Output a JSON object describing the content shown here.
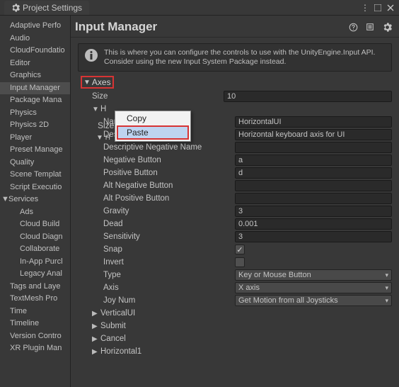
{
  "window": {
    "title": "Project Settings"
  },
  "sidebar": {
    "items": [
      {
        "label": "Adaptive Perfo",
        "child": false
      },
      {
        "label": "Audio",
        "child": false
      },
      {
        "label": "CloudFoundatio",
        "child": false
      },
      {
        "label": "Editor",
        "child": false
      },
      {
        "label": "Graphics",
        "child": false
      },
      {
        "label": "Input Manager",
        "child": false,
        "selected": true
      },
      {
        "label": "Package Mana",
        "child": false
      },
      {
        "label": "Physics",
        "child": false
      },
      {
        "label": "Physics 2D",
        "child": false
      },
      {
        "label": "Player",
        "child": false
      },
      {
        "label": "Preset Manage",
        "child": false
      },
      {
        "label": "Quality",
        "child": false
      },
      {
        "label": "Scene Templat",
        "child": false
      },
      {
        "label": "Script Executio",
        "child": false
      },
      {
        "label": "Services",
        "child": false,
        "fold": "▼"
      },
      {
        "label": "Ads",
        "child": true
      },
      {
        "label": "Cloud Build",
        "child": true
      },
      {
        "label": "Cloud Diagn",
        "child": true
      },
      {
        "label": "Collaborate",
        "child": true
      },
      {
        "label": "In-App Purcl",
        "child": true
      },
      {
        "label": "Legacy Anal",
        "child": true
      },
      {
        "label": "Tags and Laye",
        "child": false
      },
      {
        "label": "TextMesh Pro",
        "child": false
      },
      {
        "label": "Time",
        "child": false
      },
      {
        "label": "Timeline",
        "child": false
      },
      {
        "label": "Version Contro",
        "child": false
      },
      {
        "label": "XR Plugin Man",
        "child": false
      }
    ]
  },
  "content": {
    "title": "Input Manager",
    "info": "This is where you can configure the controls to use with the UnityEngine.Input API. Consider using the new Input System Package instead.",
    "axes_label": "Axes",
    "size_label": "Size",
    "size_value": "10",
    "h_label": "H",
    "props": [
      {
        "label": "Name",
        "value": "HorizontalUI",
        "type": "text"
      },
      {
        "label": "Descriptive Name",
        "value": "Horizontal keyboard axis for UI",
        "type": "text"
      },
      {
        "label": "Descriptive Negative Name",
        "value": "",
        "type": "text"
      },
      {
        "label": "Negative Button",
        "value": "a",
        "type": "text"
      },
      {
        "label": "Positive Button",
        "value": "d",
        "type": "text"
      },
      {
        "label": "Alt Negative Button",
        "value": "",
        "type": "text"
      },
      {
        "label": "Alt Positive Button",
        "value": "",
        "type": "text"
      },
      {
        "label": "Gravity",
        "value": "3",
        "type": "text"
      },
      {
        "label": "Dead",
        "value": "0.001",
        "type": "text"
      },
      {
        "label": "Sensitivity",
        "value": "3",
        "type": "text"
      },
      {
        "label": "Snap",
        "value": "✓",
        "type": "check",
        "checked": true
      },
      {
        "label": "Invert",
        "value": "",
        "type": "check",
        "checked": false
      },
      {
        "label": "Type",
        "value": "Key or Mouse Button",
        "type": "select"
      },
      {
        "label": "Axis",
        "value": "X axis",
        "type": "select"
      },
      {
        "label": "Joy Num",
        "value": "Get Motion from all Joysticks",
        "type": "select"
      }
    ],
    "trailing": [
      {
        "label": "VerticalUI"
      },
      {
        "label": "Submit"
      },
      {
        "label": "Cancel"
      },
      {
        "label": "Horizontal1"
      }
    ]
  },
  "context_menu": {
    "items": [
      "Copy",
      "Paste"
    ]
  }
}
